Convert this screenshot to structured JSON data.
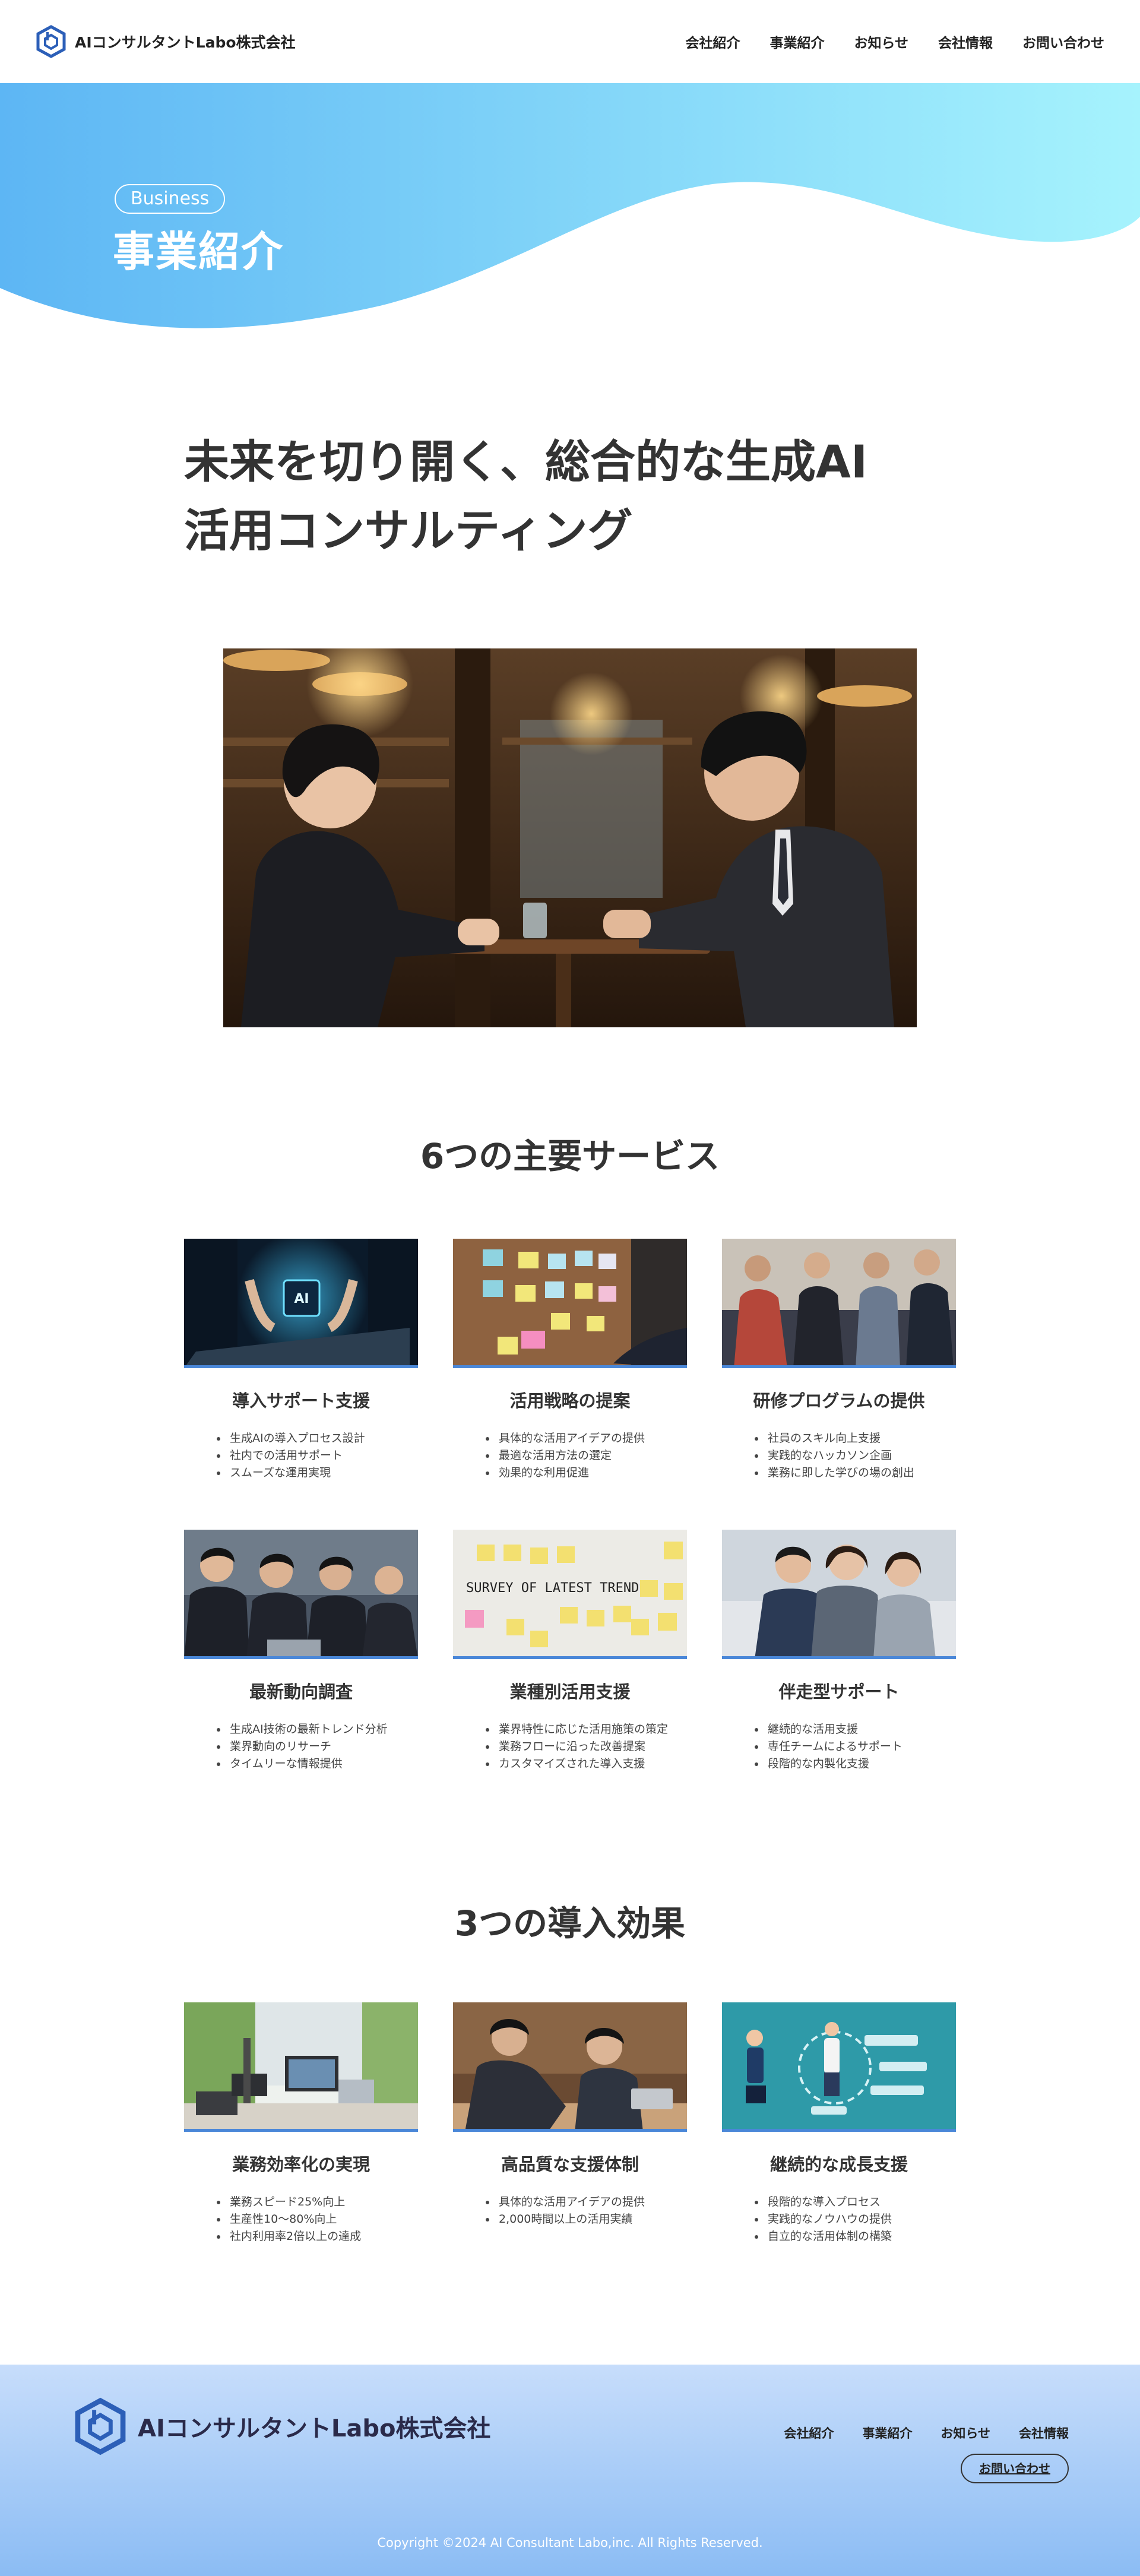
{
  "header": {
    "logo_text": "AIコンサルタントLabo株式会社",
    "nav": [
      "会社紹介",
      "事業紹介",
      "お知らせ",
      "会社情報",
      "お問い合わせ"
    ]
  },
  "hero": {
    "pill": "Business",
    "title": "事業紹介"
  },
  "intro": {
    "heading_line1": "未来を切り開く、総合的な生成AI",
    "heading_line2": "活用コンサルティング"
  },
  "services": {
    "title": "6つの主要サービス",
    "items": [
      {
        "title": "導入サポート支援",
        "points": [
          "生成AIの導入プロセス設計",
          "社内での活用サポート",
          "スムーズな運用実現"
        ]
      },
      {
        "title": "活用戦略の提案",
        "points": [
          "具体的な活用アイデアの提供",
          "最適な活用方法の選定",
          "効果的な利用促進"
        ]
      },
      {
        "title": "研修プログラムの提供",
        "points": [
          "社員のスキル向上支援",
          "実践的なハッカソン企画",
          "業務に即した学びの場の創出"
        ]
      },
      {
        "title": "最新動向調査",
        "points": [
          "生成AI技術の最新トレンド分析",
          "業界動向のリサーチ",
          "タイムリーな情報提供"
        ]
      },
      {
        "title": "業種別活用支援",
        "points": [
          "業界特性に応じた活用施策の策定",
          "業務フローに沿った改善提案",
          "カスタマイズされた導入支援"
        ]
      },
      {
        "title": "伴走型サポート",
        "points": [
          "継続的な活用支援",
          "専任チームによるサポート",
          "段階的な内製化支援"
        ]
      }
    ]
  },
  "effects": {
    "title": "3つの導入効果",
    "items": [
      {
        "title": "業務効率化の実現",
        "points": [
          "業務スピード25%向上",
          "生産性10〜80%向上",
          "社内利用率2倍以上の達成"
        ]
      },
      {
        "title": "高品質な支援体制",
        "points": [
          "具体的な活用アイデアの提供",
          "2,000時間以上の活用実績"
        ]
      },
      {
        "title": "継続的な成長支援",
        "points": [
          "段階的な導入プロセス",
          "実践的なノウハウの提供",
          "自立的な活用体制の構築"
        ]
      }
    ]
  },
  "image_text": {
    "ai_chip": "AI",
    "board": "SURVEY OF LATEST TRENDS"
  },
  "footer": {
    "logo_text": "AIコンサルタントLabo株式会社",
    "nav": [
      "会社紹介",
      "事業紹介",
      "お知らせ",
      "会社情報"
    ],
    "contact_button": "お問い合わせ",
    "copyright": "Copyright ©2024 AI Consultant Labo,inc. All Rights Reserved."
  },
  "colors": {
    "hero_gradient_start": "#5db6f4",
    "hero_gradient_end": "#a6f3fd",
    "card_accent": "#4a87d8",
    "logo_blue": "#2c5fb8",
    "footer_top": "#c7ddfb",
    "footer_bottom": "#8bbcf4"
  }
}
